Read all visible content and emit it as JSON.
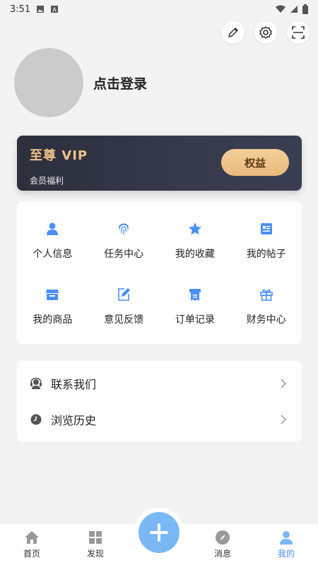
{
  "status_bar": {
    "time": "3:51"
  },
  "profile": {
    "login_label": "点击登录"
  },
  "vip": {
    "title": "至尊 VIP",
    "subtitle": "会员福利",
    "button_label": "权益"
  },
  "grid": {
    "items": [
      {
        "label": "个人信息",
        "icon": "person-icon"
      },
      {
        "label": "任务中心",
        "icon": "fingerprint-icon"
      },
      {
        "label": "我的收藏",
        "icon": "star-icon"
      },
      {
        "label": "我的帖子",
        "icon": "post-icon"
      },
      {
        "label": "我的商品",
        "icon": "shop-icon"
      },
      {
        "label": "意见反馈",
        "icon": "edit-icon"
      },
      {
        "label": "订单记录",
        "icon": "receipt-icon"
      },
      {
        "label": "财务中心",
        "icon": "gift-icon"
      }
    ]
  },
  "list": {
    "items": [
      {
        "label": "联系我们",
        "icon": "headset-icon"
      },
      {
        "label": "浏览历史",
        "icon": "clock-icon"
      }
    ]
  },
  "tabs": [
    {
      "label": "首页",
      "icon": "home-icon"
    },
    {
      "label": "发现",
      "icon": "grid-icon"
    },
    {
      "label": "",
      "icon": "plus-icon"
    },
    {
      "label": "消息",
      "icon": "compass-icon"
    },
    {
      "label": "我的",
      "icon": "user-icon"
    }
  ],
  "colors": {
    "accent": "#4a8ff5",
    "vip_gold": "#f0c08a",
    "fab": "#7ab8f5"
  }
}
